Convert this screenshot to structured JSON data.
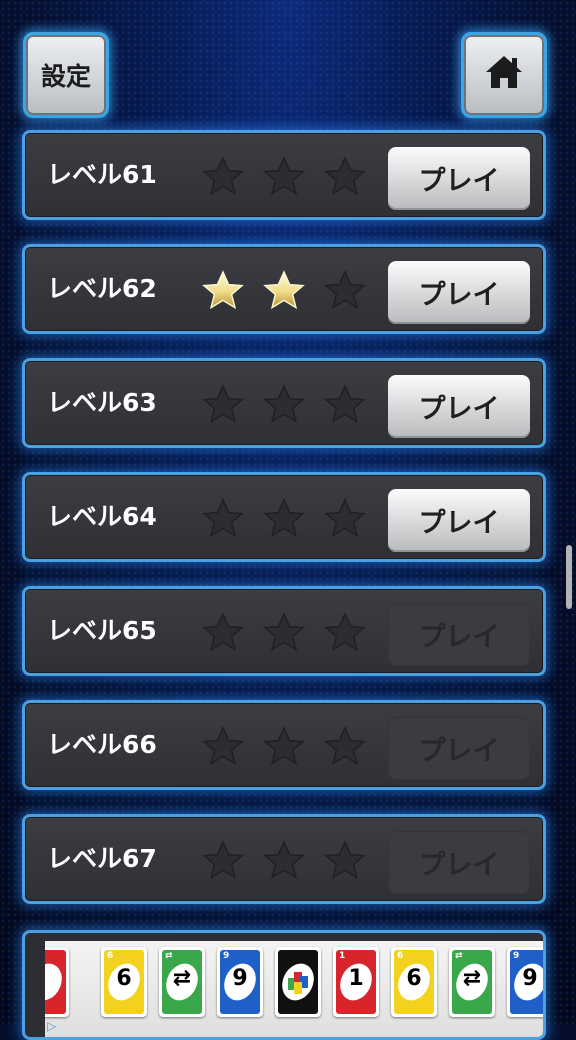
{
  "header": {
    "settings_label": "設定",
    "home_icon": "home-icon"
  },
  "colors": {
    "star_earned": "#f1dc8a",
    "star_empty": "#2c2d31",
    "row_border": "#4aa0e0",
    "card_red": "#d8252b",
    "card_yellow": "#f2d21f",
    "card_green": "#3aa84a",
    "card_blue": "#1f5fc8"
  },
  "levels": [
    {
      "label": "レベル61",
      "stars": 0,
      "play_label": "プレイ",
      "unlocked": true
    },
    {
      "label": "レベル62",
      "stars": 2,
      "play_label": "プレイ",
      "unlocked": true
    },
    {
      "label": "レベル63",
      "stars": 0,
      "play_label": "プレイ",
      "unlocked": true
    },
    {
      "label": "レベル64",
      "stars": 0,
      "play_label": "プレイ",
      "unlocked": true
    },
    {
      "label": "レベル65",
      "stars": 0,
      "play_label": "プレイ",
      "unlocked": false
    },
    {
      "label": "レベル66",
      "stars": 0,
      "play_label": "プレイ",
      "unlocked": false
    },
    {
      "label": "レベル67",
      "stars": 0,
      "play_label": "プレイ",
      "unlocked": false
    }
  ],
  "ad_banner": {
    "cards": [
      {
        "color": "red",
        "symbol": ""
      },
      {
        "color": "yellow",
        "symbol": "6"
      },
      {
        "color": "green",
        "symbol": "⇄"
      },
      {
        "color": "blue",
        "symbol": "9"
      },
      {
        "color": "wild",
        "symbol": ""
      },
      {
        "color": "red",
        "symbol": "1"
      },
      {
        "color": "yellow",
        "symbol": "6"
      },
      {
        "color": "green",
        "symbol": "⇄"
      },
      {
        "color": "blue",
        "symbol": "9"
      }
    ]
  }
}
